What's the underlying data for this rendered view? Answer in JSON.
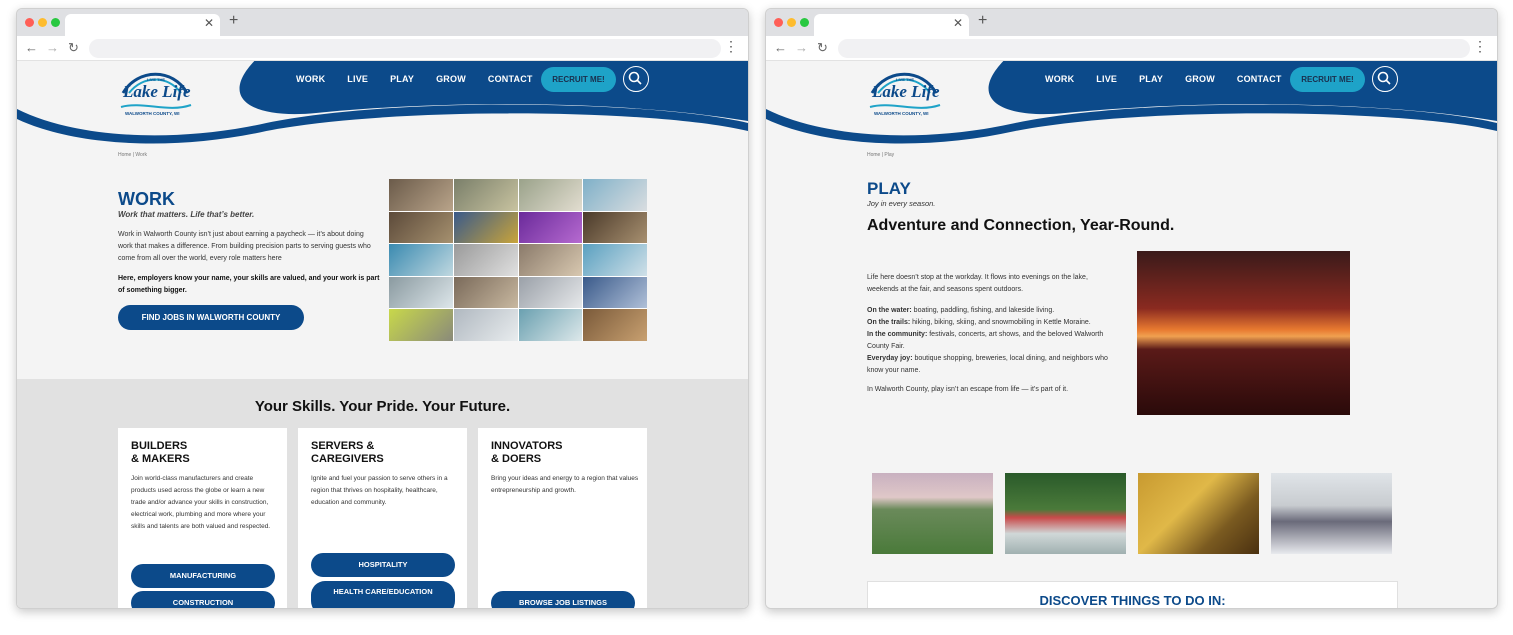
{
  "left": {
    "nav": [
      "WORK",
      "LIVE",
      "PLAY",
      "GROW",
      "CONTACT"
    ],
    "recruit": "RECRUIT ME!",
    "logo_text": {
      "top": "LIVE THE",
      "main": "Lake Life",
      "bottom": "WALWORTH COUNTY, WI"
    },
    "breadcrumb": "Home | Work",
    "title": "WORK",
    "subtitle": "Work that matters. Life that’s better.",
    "intro": "Work in Walworth County isn’t just about earning a paycheck — it’s about doing work that makes a difference. From building precision parts to serving guests who come from all over the world, every role matters here",
    "intro_bold": "Here, employers know your name, your skills are valued, and your work is part of something bigger.",
    "cta": "FIND JOBS IN WALWORTH COUNTY",
    "section_title": "Your Skills. Your Pride. Your Future.",
    "cards": [
      {
        "title_1": "BUILDERS",
        "title_2": "& MAKERS",
        "text": "Join world-class manufacturers and create products used across the globe or learn a new trade and/or advance your skills in construction, electrical work, plumbing and more where your skills and talents are both valued and respected.",
        "buttons": [
          "MANUFACTURING",
          "CONSTRUCTION"
        ]
      },
      {
        "title_1": "SERVERS &",
        "title_2": "CAREGIVERS",
        "text": "Ignite and fuel your passion to serve others in a region that thrives on hospitality, healthcare, education and community.",
        "buttons": [
          "HOSPITALITY",
          "HEALTH CARE/EDUCATION"
        ]
      },
      {
        "title_1": "INNOVATORS",
        "title_2": "& DOERS",
        "text": "Bring your ideas and energy to a region that values entrepreneurship and growth.",
        "buttons": [
          "BROWSE JOB LISTINGS"
        ]
      }
    ]
  },
  "right": {
    "nav": [
      "WORK",
      "LIVE",
      "PLAY",
      "GROW",
      "CONTACT"
    ],
    "recruit": "RECRUIT ME!",
    "logo_text": {
      "top": "LIVE THE",
      "main": "Lake Life",
      "bottom": "WALWORTH COUNTY, WI"
    },
    "breadcrumb": "Home | Play",
    "title": "PLAY",
    "subtitle": "Joy in every season.",
    "headline": "Adventure and Connection, Year-Round.",
    "intro": "Life here doesn’t stop at the workday. It flows into evenings on the lake, weekends at the fair, and seasons spent outdoors.",
    "items": [
      {
        "label": "On the water:",
        "text": " boating, paddling, fishing, and lakeside living."
      },
      {
        "label": "On the trails:",
        "text": " hiking, biking, skiing, and snowmobiling in Kettle Moraine."
      },
      {
        "label": "In the community:",
        "text": " festivals, concerts, art shows, and the beloved Walworth County Fair."
      },
      {
        "label": "Everyday joy:",
        "text": " boutique shopping, breweries, local dining, and neighbors who know your name."
      }
    ],
    "closing": "In Walworth County, play isn’t an escape from life — it’s part of it.",
    "discover": "DISCOVER THINGS TO DO IN:"
  },
  "colors": {
    "brand_blue": "#0c4a8a",
    "accent_teal": "#1ea3c8"
  }
}
